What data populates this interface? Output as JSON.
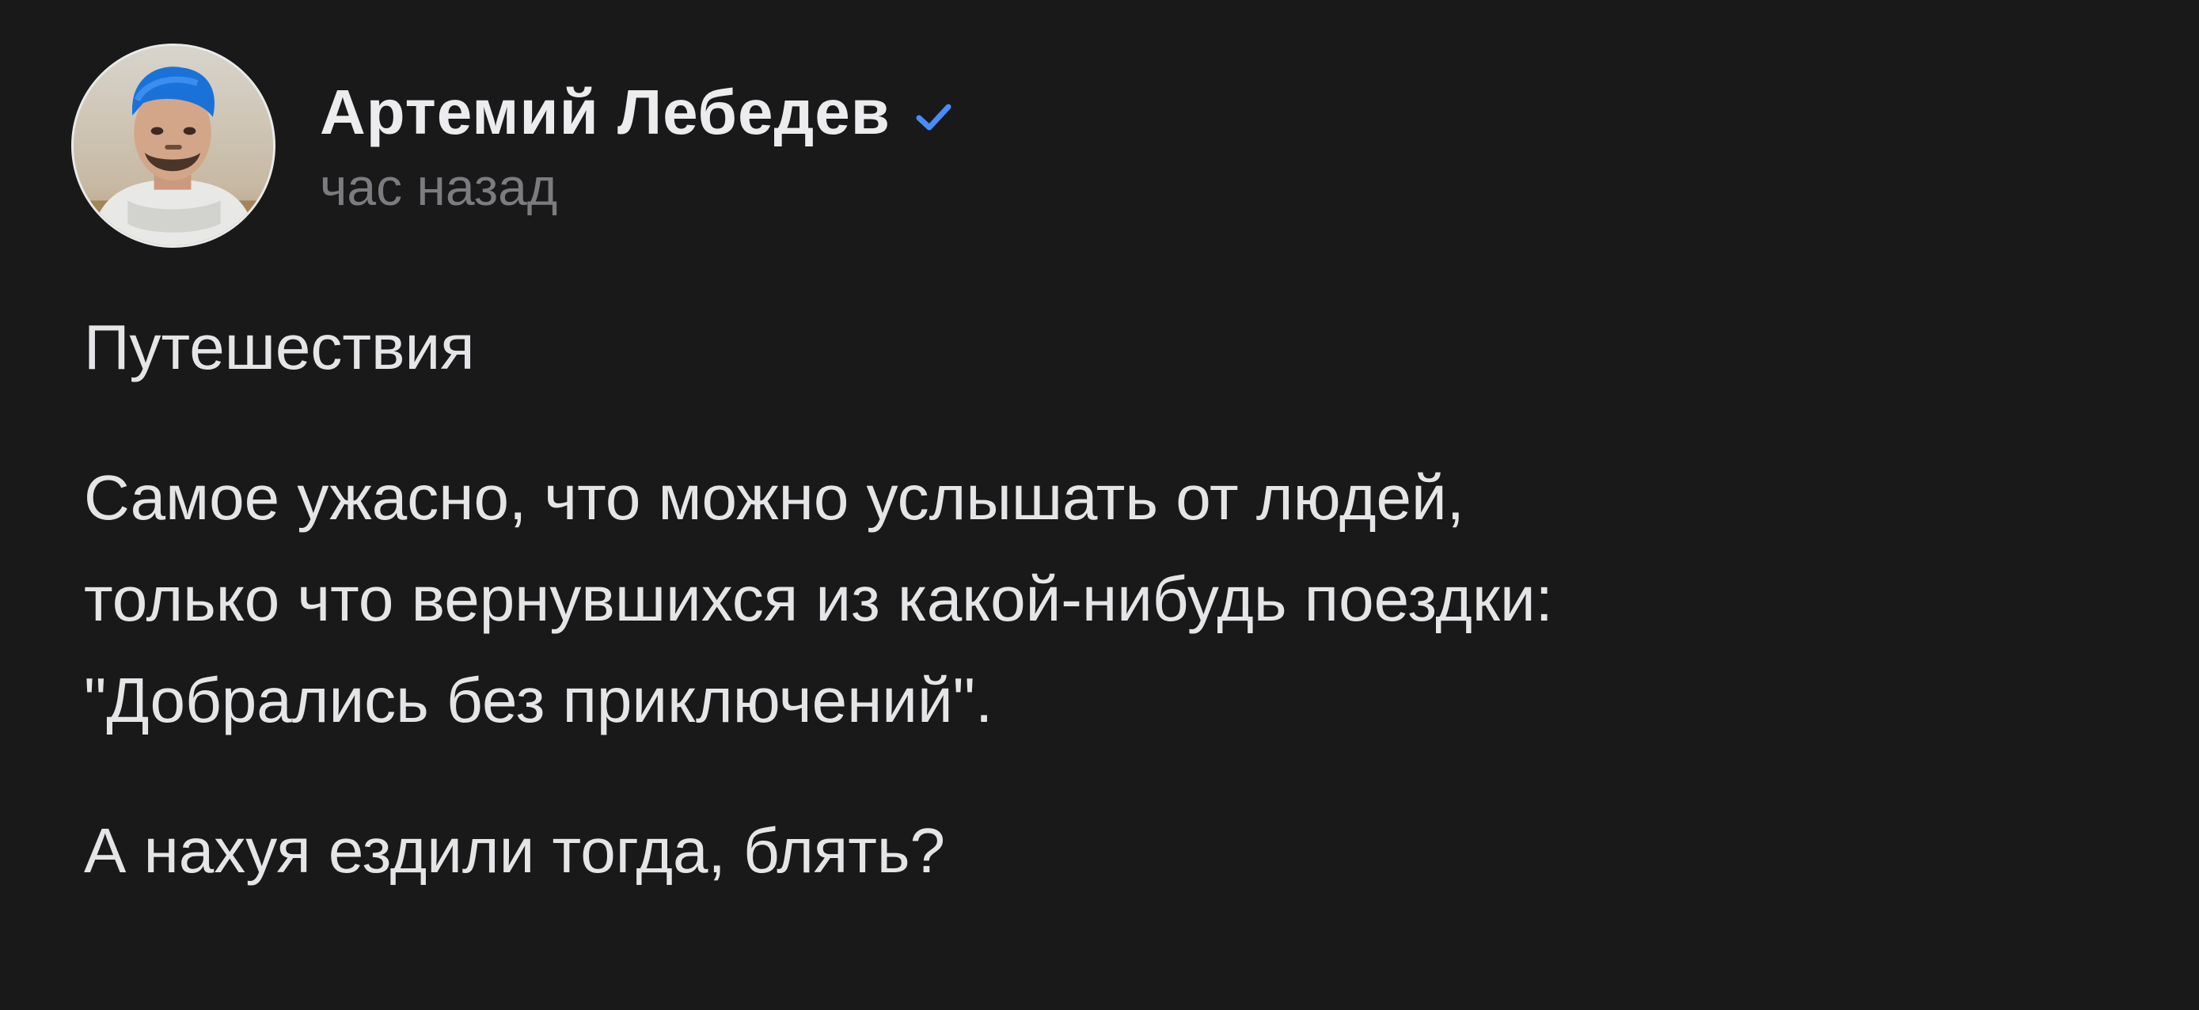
{
  "post": {
    "author_name": "Артемий Лебедев",
    "timestamp": "час назад",
    "verified_icon": "check-icon",
    "accent_color": "#4a8cf7",
    "paragraphs": [
      {
        "lines": [
          "Путешествия"
        ]
      },
      {
        "lines": [
          "Самое ужасно, что можно услышать от людей,",
          "только что вернувшихся из какой-нибудь поездки:",
          "\"Добрались без приключений\"."
        ]
      },
      {
        "lines": [
          "А нахуя ездили тогда, блять?"
        ]
      }
    ]
  }
}
